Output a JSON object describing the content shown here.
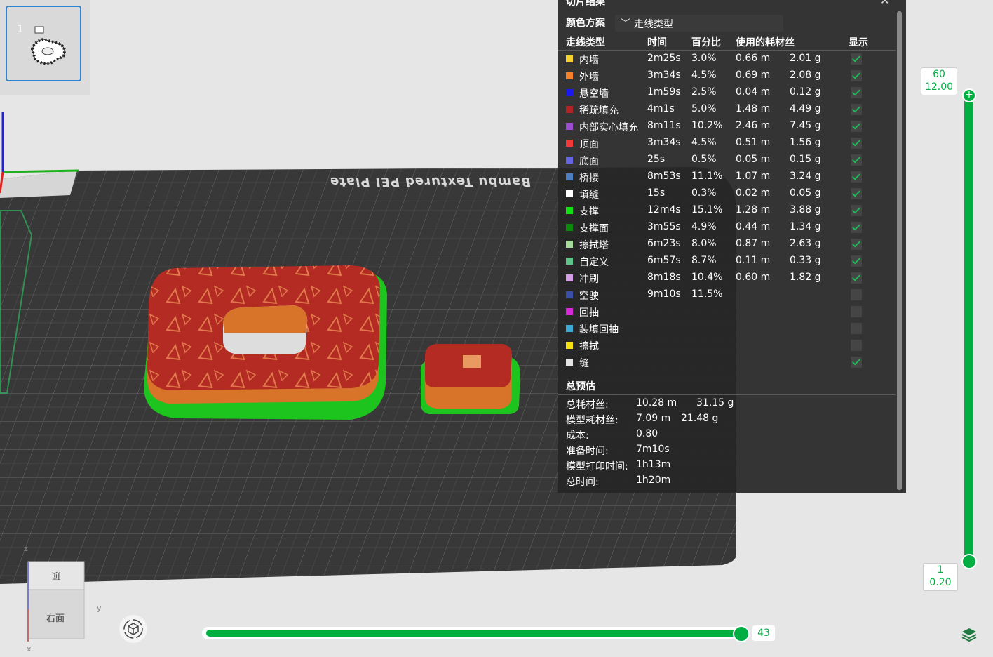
{
  "plate": {
    "number": "1"
  },
  "bed": {
    "label": "Bambu Textured PEI Plate"
  },
  "panel": {
    "title": "切片结果",
    "color_scheme_label": "颜色方案",
    "color_scheme_value": "走线类型",
    "headers": {
      "type": "走线类型",
      "time": "时间",
      "percent": "百分比",
      "filament": "使用的耗材丝",
      "display": "显示"
    },
    "rows": [
      {
        "name": "内墙",
        "color": "#f5d130",
        "time": "2m25s",
        "percent": "3.0%",
        "length": "0.66 m",
        "weight": "2.01 g",
        "shown": true,
        "checkbox": true
      },
      {
        "name": "外墙",
        "color": "#f5822a",
        "time": "3m34s",
        "percent": "4.5%",
        "length": "0.69 m",
        "weight": "2.08 g",
        "shown": true,
        "checkbox": true
      },
      {
        "name": "悬空墙",
        "color": "#1a1aef",
        "time": "1m59s",
        "percent": "2.5%",
        "length": "0.04 m",
        "weight": "0.12 g",
        "shown": true,
        "checkbox": true
      },
      {
        "name": "稀疏填充",
        "color": "#b02424",
        "time": "4m1s",
        "percent": "5.0%",
        "length": "1.48 m",
        "weight": "4.49 g",
        "shown": true,
        "checkbox": true
      },
      {
        "name": "内部实心填充",
        "color": "#9b4ed0",
        "time": "8m11s",
        "percent": "10.2%",
        "length": "2.46 m",
        "weight": "7.45 g",
        "shown": true,
        "checkbox": true
      },
      {
        "name": "顶面",
        "color": "#f03a3a",
        "time": "3m34s",
        "percent": "4.5%",
        "length": "0.51 m",
        "weight": "1.56 g",
        "shown": true,
        "checkbox": true
      },
      {
        "name": "底面",
        "color": "#6666e0",
        "time": "25s",
        "percent": "0.5%",
        "length": "0.05 m",
        "weight": "0.15 g",
        "shown": true,
        "checkbox": true
      },
      {
        "name": "桥接",
        "color": "#4f7ec0",
        "time": "8m53s",
        "percent": "11.1%",
        "length": "1.07 m",
        "weight": "3.24 g",
        "shown": true,
        "checkbox": true
      },
      {
        "name": "填缝",
        "color": "#ffffff",
        "time": "15s",
        "percent": "0.3%",
        "length": "0.02 m",
        "weight": "0.05 g",
        "shown": true,
        "checkbox": true
      },
      {
        "name": "支撑",
        "color": "#13e013",
        "time": "12m4s",
        "percent": "15.1%",
        "length": "1.28 m",
        "weight": "3.88 g",
        "shown": true,
        "checkbox": true
      },
      {
        "name": "支撑面",
        "color": "#0c8a0c",
        "time": "3m55s",
        "percent": "4.9%",
        "length": "0.44 m",
        "weight": "1.34 g",
        "shown": true,
        "checkbox": true
      },
      {
        "name": "擦拭塔",
        "color": "#a6dc9a",
        "time": "6m23s",
        "percent": "8.0%",
        "length": "0.87 m",
        "weight": "2.63 g",
        "shown": true,
        "checkbox": true
      },
      {
        "name": "自定义",
        "color": "#5ec48a",
        "time": "6m57s",
        "percent": "8.7%",
        "length": "0.11 m",
        "weight": "0.33 g",
        "shown": true,
        "checkbox": true
      },
      {
        "name": "冲刷",
        "color": "#d59ee6",
        "time": "8m18s",
        "percent": "10.4%",
        "length": "0.60 m",
        "weight": "1.82 g",
        "shown": true,
        "checkbox": true
      },
      {
        "name": "空驶",
        "color": "#3a4fa8",
        "time": "9m10s",
        "percent": "11.5%",
        "length": "",
        "weight": "",
        "shown": false,
        "checkbox": true
      },
      {
        "name": "回抽",
        "color": "#d62ad6",
        "time": "",
        "percent": "",
        "length": "",
        "weight": "",
        "shown": false,
        "checkbox": true
      },
      {
        "name": "装填回抽",
        "color": "#3fa9d6",
        "time": "",
        "percent": "",
        "length": "",
        "weight": "",
        "shown": false,
        "checkbox": true
      },
      {
        "name": "擦拭",
        "color": "#f5e20f",
        "time": "",
        "percent": "",
        "length": "",
        "weight": "",
        "shown": false,
        "checkbox": true
      },
      {
        "name": "缝",
        "color": "#e6e6e6",
        "time": "",
        "percent": "",
        "length": "",
        "weight": "",
        "shown": true,
        "checkbox": true
      }
    ],
    "estimate_title": "总预估",
    "estimates": [
      {
        "label": "总耗材丝:",
        "v1": "10.28 m",
        "v2": "31.15 g"
      },
      {
        "label": "模型耗材丝:",
        "v1": "7.09 m",
        "v2": "21.48 g"
      },
      {
        "label": "成本:",
        "v1": "0.80",
        "v2": ""
      },
      {
        "label": "准备时间:",
        "v1": "7m10s",
        "v2": ""
      },
      {
        "label": "模型打印时间:",
        "v1": "1h13m",
        "v2": ""
      },
      {
        "label": "总时间:",
        "v1": "1h20m",
        "v2": ""
      }
    ]
  },
  "layer_slider": {
    "top_layer": "60",
    "top_height": "12.00",
    "bottom_layer": "1",
    "bottom_height": "0.20"
  },
  "move_slider": {
    "value": "43"
  },
  "view_cube": {
    "top_face": "顶",
    "front_face": "右面",
    "axis_z": "z",
    "axis_y": "y",
    "axis_x": "x"
  },
  "colors": {
    "accent": "#00ae42",
    "model_top": "#b02424",
    "model_side": "#d8742a",
    "support": "#13e013",
    "bed": "#3a3a3a"
  }
}
